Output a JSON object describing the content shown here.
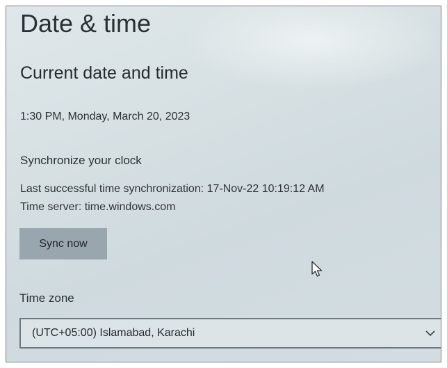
{
  "page": {
    "title": "Date & time"
  },
  "current": {
    "heading": "Current date and time",
    "value": "1:30 PM, Monday, March 20, 2023"
  },
  "sync": {
    "heading": "Synchronize your clock",
    "last_sync": "Last successful time synchronization: 17-Nov-22 10:19:12 AM",
    "server": "Time server: time.windows.com",
    "button_label": "Sync now"
  },
  "timezone": {
    "label": "Time zone",
    "selected": "(UTC+05:00) Islamabad, Karachi",
    "icon": "chevron-down-icon"
  },
  "colors": {
    "background": "#d6e0e3",
    "button": "#9aa6ae",
    "text": "#2b3035"
  }
}
